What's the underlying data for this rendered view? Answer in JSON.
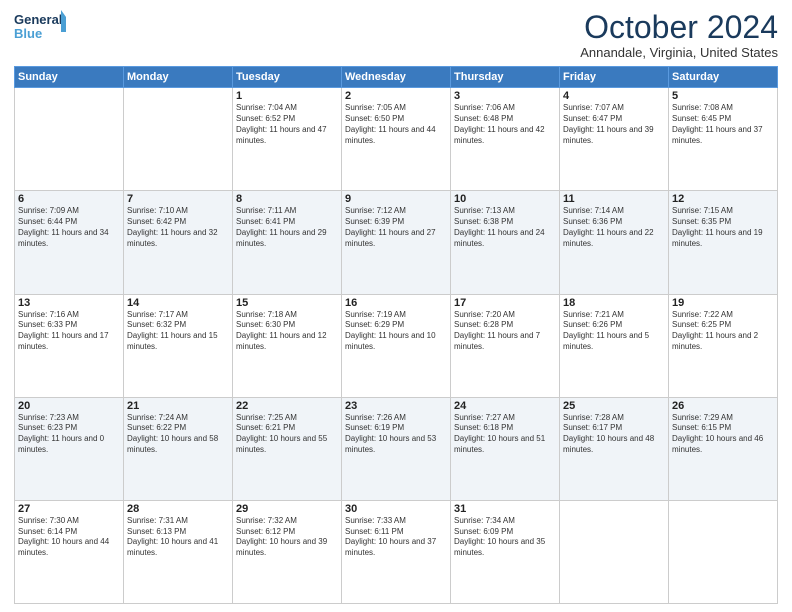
{
  "header": {
    "logo_line1": "General",
    "logo_line2": "Blue",
    "title": "October 2024",
    "subtitle": "Annandale, Virginia, United States"
  },
  "weekdays": [
    "Sunday",
    "Monday",
    "Tuesday",
    "Wednesday",
    "Thursday",
    "Friday",
    "Saturday"
  ],
  "weeks": [
    [
      {
        "day": "",
        "info": ""
      },
      {
        "day": "",
        "info": ""
      },
      {
        "day": "1",
        "info": "Sunrise: 7:04 AM\nSunset: 6:52 PM\nDaylight: 11 hours and 47 minutes."
      },
      {
        "day": "2",
        "info": "Sunrise: 7:05 AM\nSunset: 6:50 PM\nDaylight: 11 hours and 44 minutes."
      },
      {
        "day": "3",
        "info": "Sunrise: 7:06 AM\nSunset: 6:48 PM\nDaylight: 11 hours and 42 minutes."
      },
      {
        "day": "4",
        "info": "Sunrise: 7:07 AM\nSunset: 6:47 PM\nDaylight: 11 hours and 39 minutes."
      },
      {
        "day": "5",
        "info": "Sunrise: 7:08 AM\nSunset: 6:45 PM\nDaylight: 11 hours and 37 minutes."
      }
    ],
    [
      {
        "day": "6",
        "info": "Sunrise: 7:09 AM\nSunset: 6:44 PM\nDaylight: 11 hours and 34 minutes."
      },
      {
        "day": "7",
        "info": "Sunrise: 7:10 AM\nSunset: 6:42 PM\nDaylight: 11 hours and 32 minutes."
      },
      {
        "day": "8",
        "info": "Sunrise: 7:11 AM\nSunset: 6:41 PM\nDaylight: 11 hours and 29 minutes."
      },
      {
        "day": "9",
        "info": "Sunrise: 7:12 AM\nSunset: 6:39 PM\nDaylight: 11 hours and 27 minutes."
      },
      {
        "day": "10",
        "info": "Sunrise: 7:13 AM\nSunset: 6:38 PM\nDaylight: 11 hours and 24 minutes."
      },
      {
        "day": "11",
        "info": "Sunrise: 7:14 AM\nSunset: 6:36 PM\nDaylight: 11 hours and 22 minutes."
      },
      {
        "day": "12",
        "info": "Sunrise: 7:15 AM\nSunset: 6:35 PM\nDaylight: 11 hours and 19 minutes."
      }
    ],
    [
      {
        "day": "13",
        "info": "Sunrise: 7:16 AM\nSunset: 6:33 PM\nDaylight: 11 hours and 17 minutes."
      },
      {
        "day": "14",
        "info": "Sunrise: 7:17 AM\nSunset: 6:32 PM\nDaylight: 11 hours and 15 minutes."
      },
      {
        "day": "15",
        "info": "Sunrise: 7:18 AM\nSunset: 6:30 PM\nDaylight: 11 hours and 12 minutes."
      },
      {
        "day": "16",
        "info": "Sunrise: 7:19 AM\nSunset: 6:29 PM\nDaylight: 11 hours and 10 minutes."
      },
      {
        "day": "17",
        "info": "Sunrise: 7:20 AM\nSunset: 6:28 PM\nDaylight: 11 hours and 7 minutes."
      },
      {
        "day": "18",
        "info": "Sunrise: 7:21 AM\nSunset: 6:26 PM\nDaylight: 11 hours and 5 minutes."
      },
      {
        "day": "19",
        "info": "Sunrise: 7:22 AM\nSunset: 6:25 PM\nDaylight: 11 hours and 2 minutes."
      }
    ],
    [
      {
        "day": "20",
        "info": "Sunrise: 7:23 AM\nSunset: 6:23 PM\nDaylight: 11 hours and 0 minutes."
      },
      {
        "day": "21",
        "info": "Sunrise: 7:24 AM\nSunset: 6:22 PM\nDaylight: 10 hours and 58 minutes."
      },
      {
        "day": "22",
        "info": "Sunrise: 7:25 AM\nSunset: 6:21 PM\nDaylight: 10 hours and 55 minutes."
      },
      {
        "day": "23",
        "info": "Sunrise: 7:26 AM\nSunset: 6:19 PM\nDaylight: 10 hours and 53 minutes."
      },
      {
        "day": "24",
        "info": "Sunrise: 7:27 AM\nSunset: 6:18 PM\nDaylight: 10 hours and 51 minutes."
      },
      {
        "day": "25",
        "info": "Sunrise: 7:28 AM\nSunset: 6:17 PM\nDaylight: 10 hours and 48 minutes."
      },
      {
        "day": "26",
        "info": "Sunrise: 7:29 AM\nSunset: 6:15 PM\nDaylight: 10 hours and 46 minutes."
      }
    ],
    [
      {
        "day": "27",
        "info": "Sunrise: 7:30 AM\nSunset: 6:14 PM\nDaylight: 10 hours and 44 minutes."
      },
      {
        "day": "28",
        "info": "Sunrise: 7:31 AM\nSunset: 6:13 PM\nDaylight: 10 hours and 41 minutes."
      },
      {
        "day": "29",
        "info": "Sunrise: 7:32 AM\nSunset: 6:12 PM\nDaylight: 10 hours and 39 minutes."
      },
      {
        "day": "30",
        "info": "Sunrise: 7:33 AM\nSunset: 6:11 PM\nDaylight: 10 hours and 37 minutes."
      },
      {
        "day": "31",
        "info": "Sunrise: 7:34 AM\nSunset: 6:09 PM\nDaylight: 10 hours and 35 minutes."
      },
      {
        "day": "",
        "info": ""
      },
      {
        "day": "",
        "info": ""
      }
    ]
  ]
}
